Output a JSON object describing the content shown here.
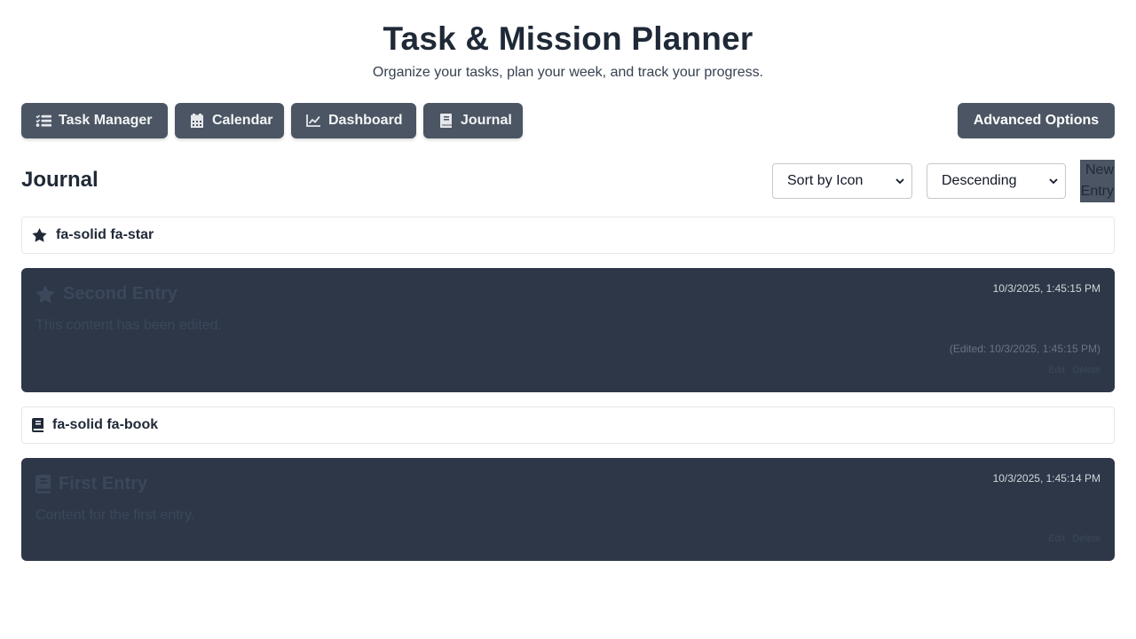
{
  "header": {
    "title": "Task & Mission Planner",
    "subtitle": "Organize your tasks, plan your week, and track your progress."
  },
  "nav": {
    "tabs": [
      {
        "label": "Task Manager",
        "icon": "list-check-icon"
      },
      {
        "label": "Calendar",
        "icon": "calendar-icon"
      },
      {
        "label": "Dashboard",
        "icon": "chart-line-icon"
      },
      {
        "label": "Journal",
        "icon": "book-icon"
      }
    ],
    "advanced_label": "Advanced Options"
  },
  "journal": {
    "title": "Journal",
    "sort_select": "Sort by Icon",
    "order_select": "Descending",
    "new_entry_label": "New Entry",
    "groups": [
      {
        "label": "fa-solid fa-star",
        "icon": "star-icon",
        "entries": [
          {
            "title": "Second Entry",
            "date": "10/3/2025, 1:45:15 PM",
            "content": "This content has been edited.",
            "edited": "(Edited: 10/3/2025, 1:45:15 PM)",
            "edit_label": "Edit",
            "delete_label": "Delete"
          }
        ]
      },
      {
        "label": "fa-solid fa-book",
        "icon": "book-icon",
        "entries": [
          {
            "title": "First Entry",
            "date": "10/3/2025, 1:45:14 PM",
            "content": "Content for the first entry.",
            "edit_label": "Edit",
            "delete_label": "Delete"
          }
        ]
      }
    ]
  },
  "colors": {
    "nav_bg": "#4b5563",
    "entry_bg": "#2e3748",
    "text_dark": "#1f2937"
  }
}
